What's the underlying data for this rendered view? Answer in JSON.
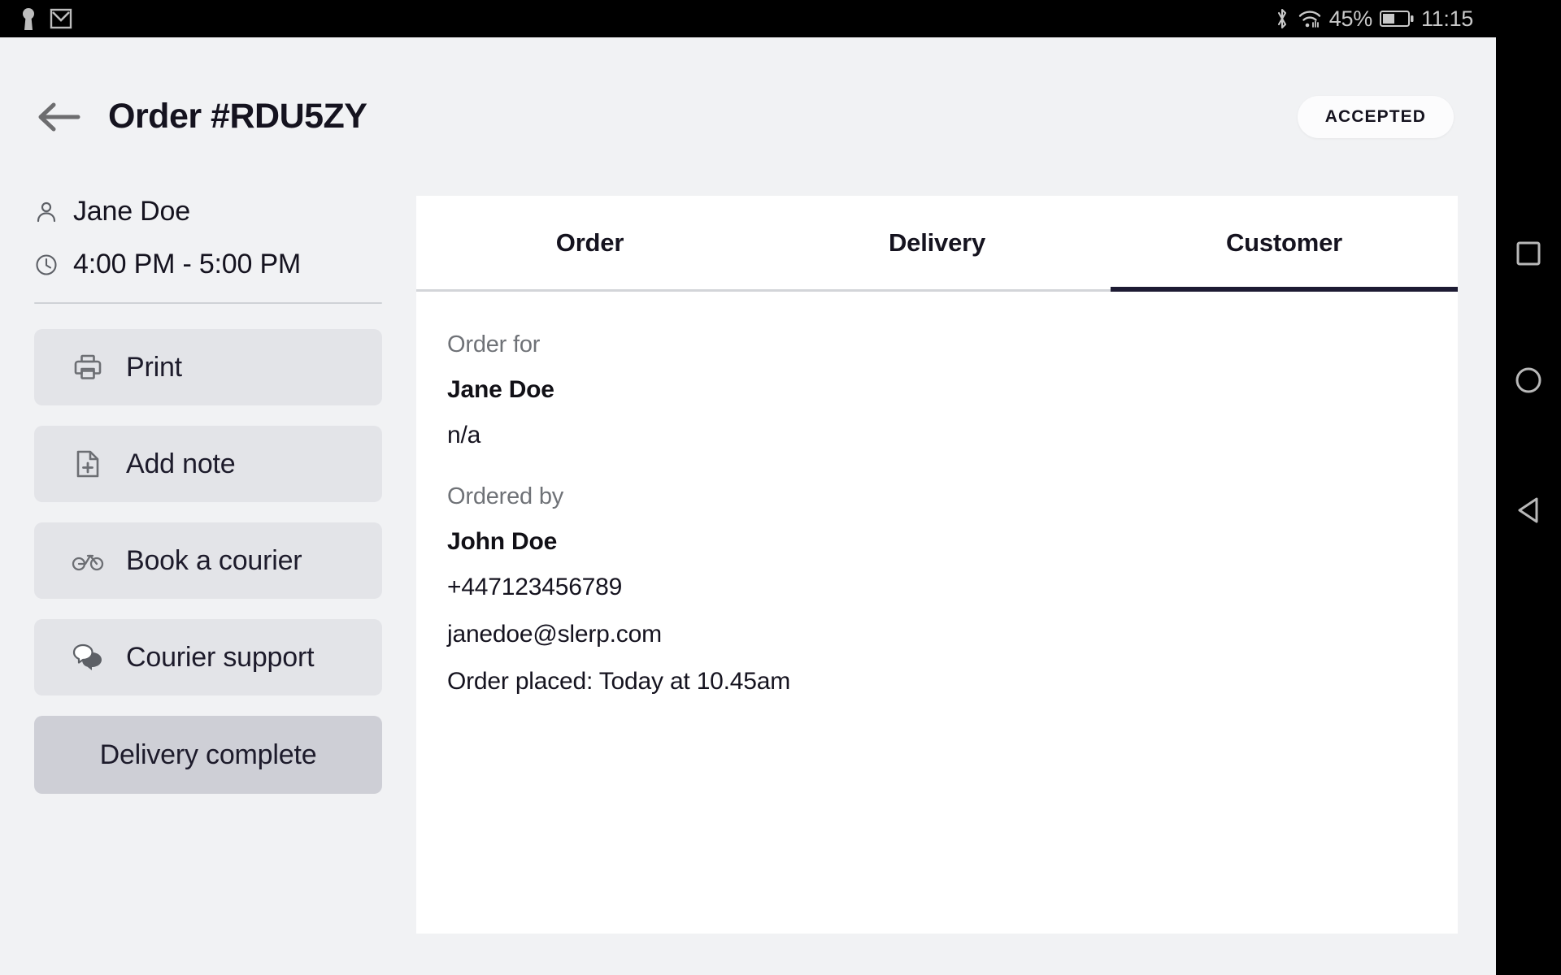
{
  "statusbar": {
    "left_icons": [
      "keyhole-icon",
      "gmail-icon"
    ],
    "battery_percent": "45%",
    "time": "11:15",
    "right_icons": [
      "bluetooth-icon",
      "wifi-icon",
      "battery-icon"
    ]
  },
  "navbar": {
    "recents_label": "recents",
    "home_label": "home",
    "back_label": "back"
  },
  "header": {
    "back_label": "Back",
    "title": "Order #RDU5ZY",
    "status": "ACCEPTED"
  },
  "sidebar": {
    "customer_name": "Jane Doe",
    "time_slot": "4:00 PM - 5:00 PM",
    "actions": [
      {
        "label": "Print",
        "icon": "printer-icon"
      },
      {
        "label": "Add note",
        "icon": "note-add-icon"
      },
      {
        "label": "Book a courier",
        "icon": "bicycle-icon"
      },
      {
        "label": "Courier support",
        "icon": "chat-bubbles-icon"
      }
    ],
    "primary_action": {
      "label": "Delivery complete"
    }
  },
  "main": {
    "tabs": [
      {
        "label": "Order",
        "active": false
      },
      {
        "label": "Delivery",
        "active": false
      },
      {
        "label": "Customer",
        "active": true
      }
    ],
    "order_for": {
      "label": "Order for",
      "name": "Jane Doe",
      "detail": "n/a"
    },
    "ordered_by": {
      "label": "Ordered by",
      "name": "John Doe",
      "phone": "+447123456789",
      "email": "janedoe@slerp.com",
      "placed": "Order placed: Today at 10.45am"
    }
  },
  "colors": {
    "page_bg": "#f1f2f4",
    "card_bg": "#ffffff",
    "action_bg": "#e3e4e8",
    "primary_action_bg": "#cecfd6",
    "accent_underline": "#1d1b33",
    "text_primary": "#15131f",
    "text_muted": "#6f7277",
    "status_bar_bg": "#000000",
    "status_bar_text": "#c9c9c9"
  }
}
